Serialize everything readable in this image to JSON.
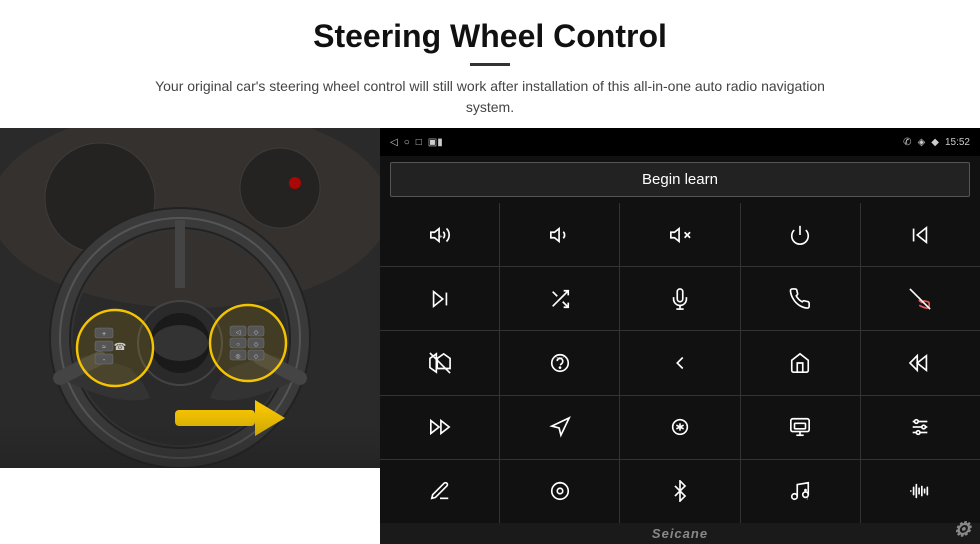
{
  "header": {
    "title": "Steering Wheel Control",
    "subtitle": "Your original car's steering wheel control will still work after installation of this all-in-one auto radio navigation system."
  },
  "status_bar": {
    "left_icons": [
      "◁",
      "○",
      "□"
    ],
    "signal": "▣▣",
    "phone": "✆",
    "location": "◈",
    "wifi": "◆",
    "time": "15:52"
  },
  "begin_learn": {
    "label": "Begin learn"
  },
  "grid_icons": [
    {
      "name": "vol-up",
      "symbol": "vol+"
    },
    {
      "name": "vol-down",
      "symbol": "vol-"
    },
    {
      "name": "mute",
      "symbol": "mute"
    },
    {
      "name": "power",
      "symbol": "pwr"
    },
    {
      "name": "prev-track",
      "symbol": "prev"
    },
    {
      "name": "skip-forward",
      "symbol": "skip+"
    },
    {
      "name": "shuffle",
      "symbol": "shfl"
    },
    {
      "name": "mic",
      "symbol": "mic"
    },
    {
      "name": "phone",
      "symbol": "tel"
    },
    {
      "name": "hang-up",
      "symbol": "hung"
    },
    {
      "name": "camera",
      "symbol": "cam"
    },
    {
      "name": "360-view",
      "symbol": "360"
    },
    {
      "name": "back",
      "symbol": "bck"
    },
    {
      "name": "home",
      "symbol": "hom"
    },
    {
      "name": "skip-back",
      "symbol": "skpb"
    },
    {
      "name": "fast-forward",
      "symbol": "fwd"
    },
    {
      "name": "navigate",
      "symbol": "nav"
    },
    {
      "name": "equalizer",
      "symbol": "eq"
    },
    {
      "name": "media",
      "symbol": "med"
    },
    {
      "name": "settings-sliders",
      "symbol": "sld"
    },
    {
      "name": "pen",
      "symbol": "pen"
    },
    {
      "name": "radio",
      "symbol": "rad"
    },
    {
      "name": "bluetooth",
      "symbol": "bt"
    },
    {
      "name": "music",
      "symbol": "mus"
    },
    {
      "name": "waveform",
      "symbol": "wav"
    }
  ],
  "watermark": {
    "text": "Seicane"
  }
}
